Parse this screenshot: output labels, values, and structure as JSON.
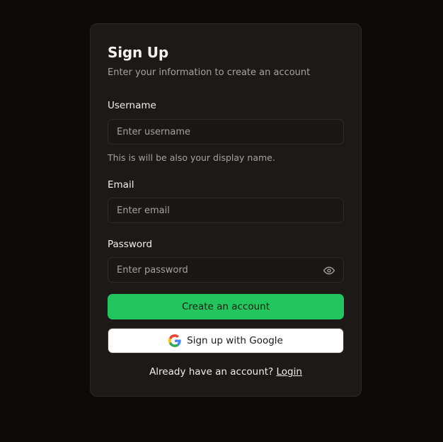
{
  "form": {
    "title": "Sign Up",
    "subtitle": "Enter your information to create an account",
    "username": {
      "label": "Username",
      "placeholder": "Enter username",
      "value": "",
      "hint": "This is will be also your display name."
    },
    "email": {
      "label": "Email",
      "placeholder": "Enter email",
      "value": ""
    },
    "password": {
      "label": "Password",
      "placeholder": "Enter password",
      "value": "",
      "toggle_icon": "eye-icon"
    },
    "create_button_label": "Create an account",
    "google_button_label": "Sign up with Google",
    "google_icon": "google-icon",
    "footer_text": "Already have an account?",
    "login_link": "Login"
  },
  "colors": {
    "background": "#0c0b0a",
    "card": "#1c1917",
    "accent": "#22c55e",
    "muted_text": "#a8a29e"
  }
}
